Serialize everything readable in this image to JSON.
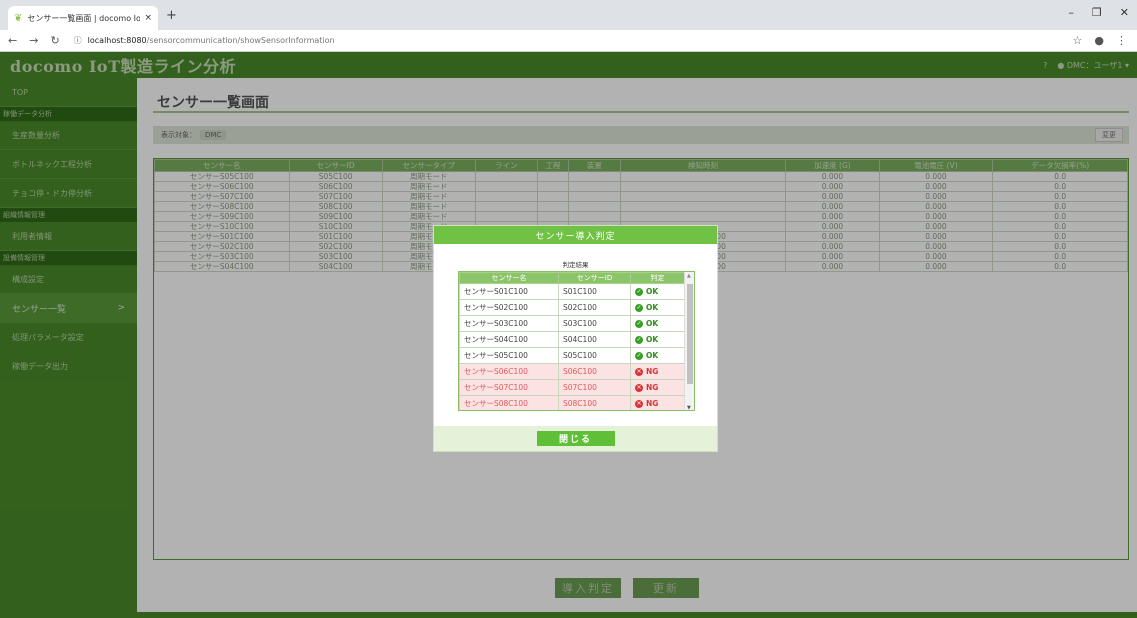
{
  "browser": {
    "tab_title": "センサー一覧画面 | docomo IoT製",
    "tab_close": "×",
    "new_tab": "+",
    "url_host": "localhost:8080",
    "url_path": "/sensorcommunication/showSensorInformation"
  },
  "header": {
    "app_title": "docomo IoT製造ライン分析",
    "user_label": "DMC：ユーザ1"
  },
  "sidebar": {
    "items": [
      {
        "type": "item",
        "label": "TOP"
      },
      {
        "type": "section",
        "label": "稼働データ分析"
      },
      {
        "type": "item",
        "label": "生産数量分析"
      },
      {
        "type": "item",
        "label": "ボトルネック工程分析"
      },
      {
        "type": "item",
        "label": "チョコ停・ドカ停分析"
      },
      {
        "type": "section",
        "label": "組織情報管理"
      },
      {
        "type": "item",
        "label": "利用者情報"
      },
      {
        "type": "section",
        "label": "設備情報管理"
      },
      {
        "type": "item",
        "label": "構成設定"
      },
      {
        "type": "active",
        "label": "センサー一覧",
        "arrow": ">"
      },
      {
        "type": "plain",
        "label": "処理パラメータ設定"
      },
      {
        "type": "plain",
        "label": "稼働データ出力"
      }
    ]
  },
  "main": {
    "title": "センサー一覧画面",
    "filter_label": "表示対象：",
    "filter_value": "DMC",
    "change_button": "変更",
    "columns": [
      "センサー名",
      "センサーID",
      "センサータイプ",
      "ライン",
      "工程",
      "装置",
      "検知時刻",
      "加速度 (G)",
      "電池電圧 (V)",
      "データ欠損率(%)"
    ],
    "rows": [
      [
        "センサーS05C100",
        "S05C100",
        "周期モード",
        "",
        "",
        "",
        "",
        "0.000",
        "0.000",
        "0.0"
      ],
      [
        "センサーS06C100",
        "S06C100",
        "周期モード",
        "",
        "",
        "",
        "",
        "0.000",
        "0.000",
        "0.0"
      ],
      [
        "センサーS07C100",
        "S07C100",
        "周期モード",
        "",
        "",
        "",
        "",
        "0.000",
        "0.000",
        "0.0"
      ],
      [
        "センサーS08C100",
        "S08C100",
        "周期モード",
        "",
        "",
        "",
        "",
        "0.000",
        "0.000",
        "0.0"
      ],
      [
        "センサーS09C100",
        "S09C100",
        "周期モード",
        "",
        "",
        "",
        "",
        "0.000",
        "0.000",
        "0.0"
      ],
      [
        "センサーS10C100",
        "S10C100",
        "周期モード",
        "",
        "",
        "",
        "",
        "0.000",
        "0.000",
        "0.0"
      ],
      [
        "センサーS01C100",
        "S01C100",
        "周期モード",
        "",
        "",
        "",
        "05 12:00:00",
        "0.000",
        "0.000",
        "0.0"
      ],
      [
        "センサーS02C100",
        "S02C100",
        "周期モード",
        "",
        "",
        "",
        "05 12:00:00",
        "0.000",
        "0.000",
        "0.0"
      ],
      [
        "センサーS03C100",
        "S03C100",
        "周期モード",
        "",
        "",
        "",
        "05 12:00:00",
        "0.000",
        "0.000",
        "0.0"
      ],
      [
        "センサーS04C100",
        "S04C100",
        "周期モード",
        "",
        "",
        "",
        "05 12:00:00",
        "0.000",
        "0.000",
        "0.0"
      ]
    ],
    "buttons": {
      "install_judge": "導入判定",
      "refresh": "更新"
    }
  },
  "modal": {
    "title": "センサー導入判定",
    "subtitle": "判定結果",
    "columns": [
      "センサー名",
      "センサーID",
      "判定"
    ],
    "rows": [
      {
        "name": "センサーS01C100",
        "id": "S01C100",
        "verdict": "OK"
      },
      {
        "name": "センサーS02C100",
        "id": "S02C100",
        "verdict": "OK"
      },
      {
        "name": "センサーS03C100",
        "id": "S03C100",
        "verdict": "OK"
      },
      {
        "name": "センサーS04C100",
        "id": "S04C100",
        "verdict": "OK"
      },
      {
        "name": "センサーS05C100",
        "id": "S05C100",
        "verdict": "OK"
      },
      {
        "name": "センサーS06C100",
        "id": "S06C100",
        "verdict": "NG"
      },
      {
        "name": "センサーS07C100",
        "id": "S07C100",
        "verdict": "NG"
      },
      {
        "name": "センサーS08C100",
        "id": "S08C100",
        "verdict": "NG"
      }
    ],
    "close_button": "閉じる"
  },
  "colors": {
    "brand_green": "#4a8c2a",
    "modal_green": "#6fc244",
    "ok": "#2e8b1e",
    "ng": "#d93434"
  }
}
